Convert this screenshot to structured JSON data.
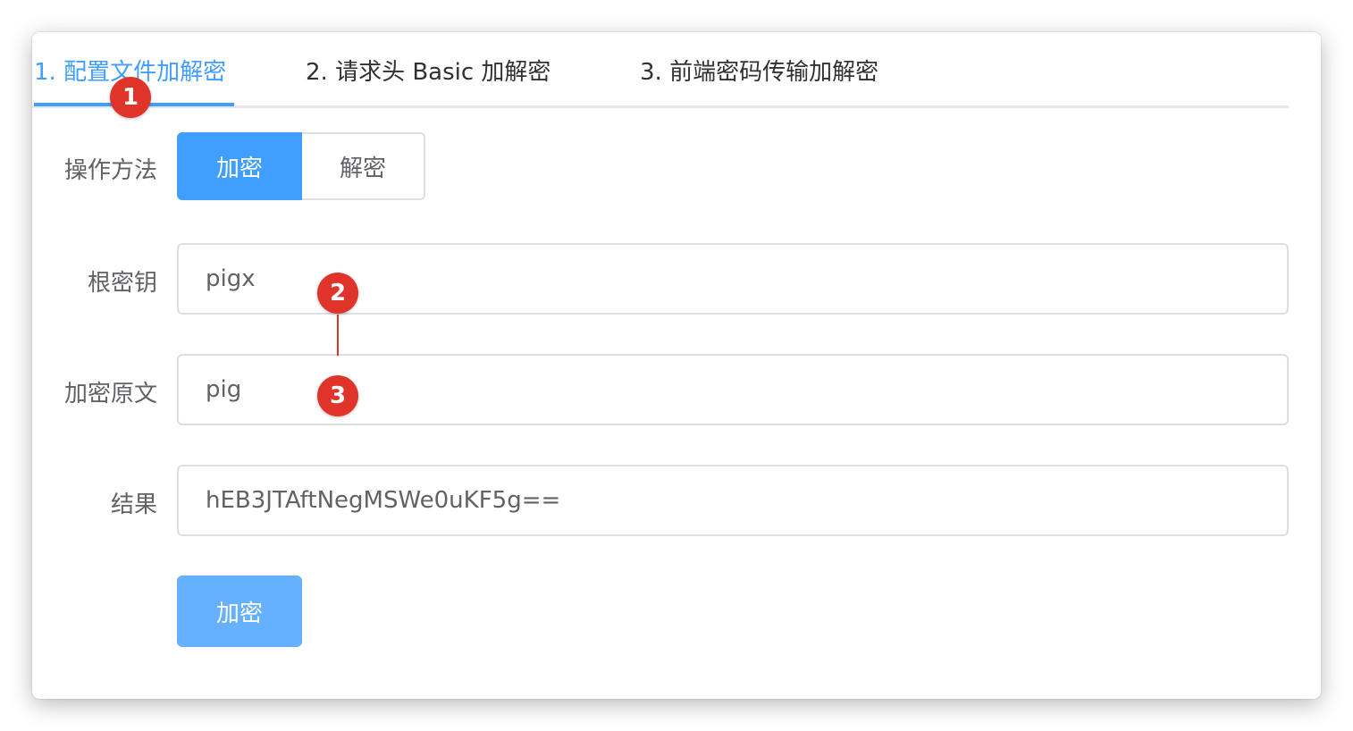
{
  "tabs": [
    {
      "label": "1. 配置文件加解密",
      "active": true
    },
    {
      "label": "2. 请求头 Basic 加解密",
      "active": false
    },
    {
      "label": "3. 前端密码传输加解密",
      "active": false
    }
  ],
  "form": {
    "operation": {
      "label": "操作方法",
      "options": [
        "加密",
        "解密"
      ],
      "selected": "加密"
    },
    "root_key": {
      "label": "根密钥",
      "value": "pigx"
    },
    "plaintext": {
      "label": "加密原文",
      "value": "pig"
    },
    "result": {
      "label": "结果",
      "value": "hEB3JTAftNegMSWe0uKF5g=="
    },
    "submit_label": "加密"
  },
  "annotations": [
    "1",
    "2",
    "3"
  ],
  "colors": {
    "primary": "#409eff",
    "primary_light": "#66b1ff",
    "annotation": "#e0342a"
  }
}
